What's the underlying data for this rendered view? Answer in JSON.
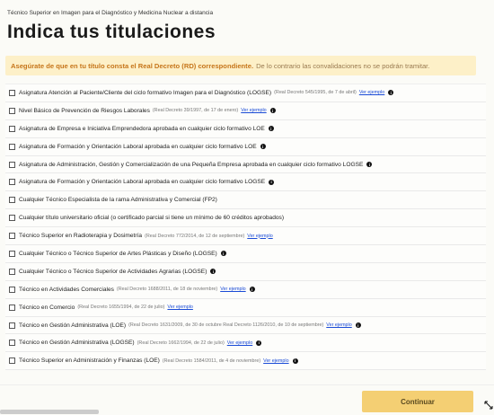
{
  "breadcrumb": "Técnico Superior en Imagen para el Diagnóstico y Medicina Nuclear a distancia",
  "title": "Indica tus titulaciones",
  "notice": {
    "bold": "Asegúrate de que en tu título consta el Real Decreto (RD) correspondiente.",
    "rest": "De lo contrario las convalidaciones no se podrán tramitar."
  },
  "items": [
    {
      "label": "Asignatura Atención al Paciente/Cliente del ciclo formativo Imagen para el Diagnóstico (LOGSE)",
      "decree": "(Real Decreto 545/1995, de 7 de abril)",
      "link": "Ver ejemplo",
      "info": true
    },
    {
      "label": "Nivel Básico de Prevención de Riesgos Laborales",
      "decree": "(Real Decreto 39/1997, de 17 de enero)",
      "link": "Ver ejemplo",
      "info": true
    },
    {
      "label": "Asignatura de Empresa e Iniciativa Emprendedora aprobada en cualquier ciclo formativo LOE",
      "decree": "",
      "link": "",
      "info": true
    },
    {
      "label": "Asignatura de Formación y Orientación Laboral aprobada en cualquier ciclo formativo LOE",
      "decree": "",
      "link": "",
      "info": true
    },
    {
      "label": "Asignatura de Administración, Gestión y Comercialización de una Pequeña Empresa aprobada en cualquier ciclo formativo LOGSE",
      "decree": "",
      "link": "",
      "info": true
    },
    {
      "label": "Asignatura de Formación y Orientación Laboral aprobada en cualquier ciclo formativo LOGSE",
      "decree": "",
      "link": "",
      "info": true
    },
    {
      "label": "Cualquier Técnico Especialista de la rama Administrativa y Comercial (FP2)",
      "decree": "",
      "link": "",
      "info": false
    },
    {
      "label": "Cualquier título universitario oficial (o certificado parcial si tiene un mínimo de 60 créditos aprobados)",
      "decree": "",
      "link": "",
      "info": false
    },
    {
      "label": "Técnico Superior en Radioterapia y Dosimetría",
      "decree": "(Real Decreto 772/2014, de 12 de septiembre)",
      "link": "Ver ejemplo",
      "info": false
    },
    {
      "label": "Cualquier Técnico o Técnico Superior de Artes Plásticas y Diseño (LOGSE)",
      "decree": "",
      "link": "",
      "info": true
    },
    {
      "label": "Cualquier Técnico o Técnico Superior de Actividades Agrarias (LOGSE)",
      "decree": "",
      "link": "",
      "info": true
    },
    {
      "label": "Técnico en Actividades Comerciales",
      "decree": "(Real Decreto 1688/2011, de 18 de noviembre)",
      "link": "Ver ejemplo",
      "info": true
    },
    {
      "label": "Técnico en Comercio",
      "decree": "(Real Decreto 1655/1994, de 22 de julio)",
      "link": "Ver ejemplo",
      "info": false
    },
    {
      "label": "Técnico en Gestión Administrativa (LOE)",
      "decree": "(Real Decreto 1631/2009, de 30 de octubre Real Decreto 1126/2010, de 10 de septiembre)",
      "link": "Ver ejemplo",
      "info": true
    },
    {
      "label": "Técnico en Gestión Administrativa (LOGSE)",
      "decree": "(Real Decreto 1662/1994, de 22 de julio)",
      "link": "Ver ejemplo",
      "info": true
    },
    {
      "label": "Técnico Superior en Administración y Finanzas (LOE)",
      "decree": "(Real Decreto 1584/2011, de 4 de noviembre)",
      "link": "Ver ejemplo",
      "info": true
    }
  ],
  "continue_label": "Continuar",
  "colors": {
    "accent": "#f4cf73",
    "notice_bg": "#fdf0c8",
    "notice_bold": "#c6751a",
    "link": "#1a4bd6"
  },
  "icons": {
    "checkbox": "checkbox-icon",
    "info": "info-icon",
    "cursor": "resize-cursor-icon"
  }
}
